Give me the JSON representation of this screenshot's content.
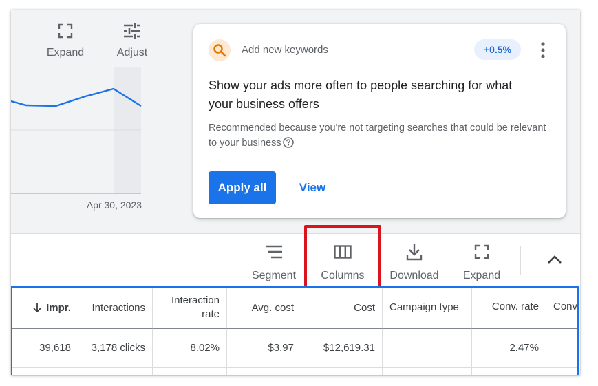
{
  "chart_panel": {
    "tools": [
      {
        "label": "Expand",
        "icon": "fullscreen-icon"
      },
      {
        "label": "Adjust",
        "icon": "tune-icon"
      }
    ],
    "date_label": "Apr 30, 2023"
  },
  "recommendation": {
    "type_label": "Add new keywords",
    "icon": "search-icon",
    "badge": "+0.5%",
    "headline": "Show your ads more often to people searching for what your business offers",
    "description": "Recommended because you're not targeting searches that could be relevant to your business",
    "apply_label": "Apply all",
    "view_label": "View"
  },
  "toolbar": {
    "segment_label": "Segment",
    "columns_label": "Columns",
    "download_label": "Download",
    "expand_label": "Expand"
  },
  "table": {
    "headers": {
      "impr": "Impr.",
      "interactions": "Interactions",
      "interaction_rate": "Interaction rate",
      "avg_cost": "Avg. cost",
      "cost": "Cost",
      "campaign_type": "Campaign type",
      "conv_rate": "Conv. rate",
      "conv": "Conv"
    },
    "row": {
      "impr": "39,618",
      "interactions": "3,178 clicks",
      "interaction_rate": "8.02%",
      "avg_cost": "$3.97",
      "cost": "$12,619.31",
      "campaign_type": "",
      "conv_rate": "2.47%",
      "conv": ""
    }
  },
  "colors": {
    "accent": "#1a73e8",
    "highlight": "#d9141c",
    "badge_bg": "#e8f0fe",
    "search_icon": "#e37400"
  }
}
